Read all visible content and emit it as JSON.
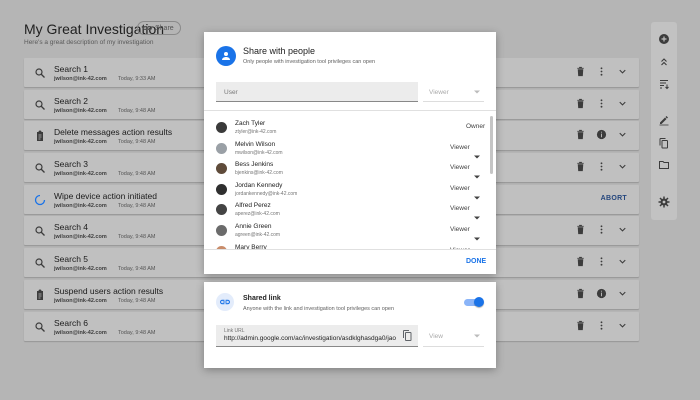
{
  "investigation": {
    "title": "My Great Investigation",
    "share_label": "Share",
    "description": "Here's a great description of my investigation"
  },
  "rows": [
    {
      "title": "Search 1",
      "user": "jwilson@ink-42.com",
      "time": "Today, 9:33 AM",
      "icon": "search-icon",
      "info": false
    },
    {
      "title": "Search 2",
      "user": "jwilson@ink-42.com",
      "time": "Today, 9:48 AM",
      "icon": "search-icon",
      "info": false
    },
    {
      "title": "Delete messages action results",
      "user": "jwilson@ink-42.com",
      "time": "Today, 9:48 AM",
      "icon": "clipboard-icon",
      "info": true
    },
    {
      "title": "Search 3",
      "user": "jwilson@ink-42.com",
      "time": "Today, 9:48 AM",
      "icon": "search-icon",
      "info": false
    },
    {
      "title": "Wipe device action initiated",
      "user": "jwilson@ink-42.com",
      "time": "Today, 9:48 AM",
      "icon": "spinner-icon",
      "abort": "ABORT"
    },
    {
      "title": "Search 4",
      "user": "jwilson@ink-42.com",
      "time": "Today, 9:48 AM",
      "icon": "search-icon",
      "info": false
    },
    {
      "title": "Search 5",
      "user": "jwilson@ink-42.com",
      "time": "Today, 9:48 AM",
      "icon": "search-icon",
      "info": false
    },
    {
      "title": "Suspend users action results",
      "user": "jwilson@ink-42.com",
      "time": "Today, 9:48 AM",
      "icon": "clipboard-icon",
      "info": true
    },
    {
      "title": "Search 6",
      "user": "jwilson@ink-42.com",
      "time": "Today, 9:48 AM",
      "icon": "search-icon",
      "info": false
    }
  ],
  "rail_icons": [
    "add-icon",
    "collapse-icon",
    "sort-icon",
    "edit-icon",
    "copy-icon",
    "folder-icon",
    "settings-icon"
  ],
  "share_dialog": {
    "title": "Share with people",
    "subtitle": "Only people with investigation tool privileges can open",
    "user_placeholder": "User",
    "role_placeholder": "Viewer",
    "people": [
      {
        "name": "Zach Tyler",
        "email": "ztyler@ink-42.com",
        "role": "Owner",
        "owner": true,
        "color": "#3a3a3a"
      },
      {
        "name": "Melvin Wilson",
        "email": "mwilson@ink-42.com",
        "role": "Viewer",
        "owner": false,
        "color": "#9aa0a6"
      },
      {
        "name": "Bess Jenkins",
        "email": "bjenkins@ink-42.com",
        "role": "Viewer",
        "owner": false,
        "color": "#5f4b3a"
      },
      {
        "name": "Jordan Kennedy",
        "email": "jordankennedy@ink-42.com",
        "role": "Viewer",
        "owner": false,
        "color": "#2f2f2f"
      },
      {
        "name": "Alfred Perez",
        "email": "aperez@ink-42.com",
        "role": "Viewer",
        "owner": false,
        "color": "#444444"
      },
      {
        "name": "Annie Green",
        "email": "agreen@ink-42.com",
        "role": "Viewer",
        "owner": false,
        "color": "#6b6b6b"
      },
      {
        "name": "Mary Berry",
        "email": "",
        "role": "Viewer",
        "owner": false,
        "color": "#c98c6a"
      }
    ],
    "done_label": "DONE"
  },
  "link_dialog": {
    "title": "Shared link",
    "subtitle": "Anyone with the link and investigation tool privileges can open",
    "enabled": true,
    "url_label": "Link URL",
    "url": "http://admin.google.com/ac/investigation/asdklghasdga0/jao",
    "view_placeholder": "View"
  },
  "colors": {
    "accent": "#1a73e8",
    "overlay": "#b5b5b5",
    "abort": "#25477e"
  }
}
